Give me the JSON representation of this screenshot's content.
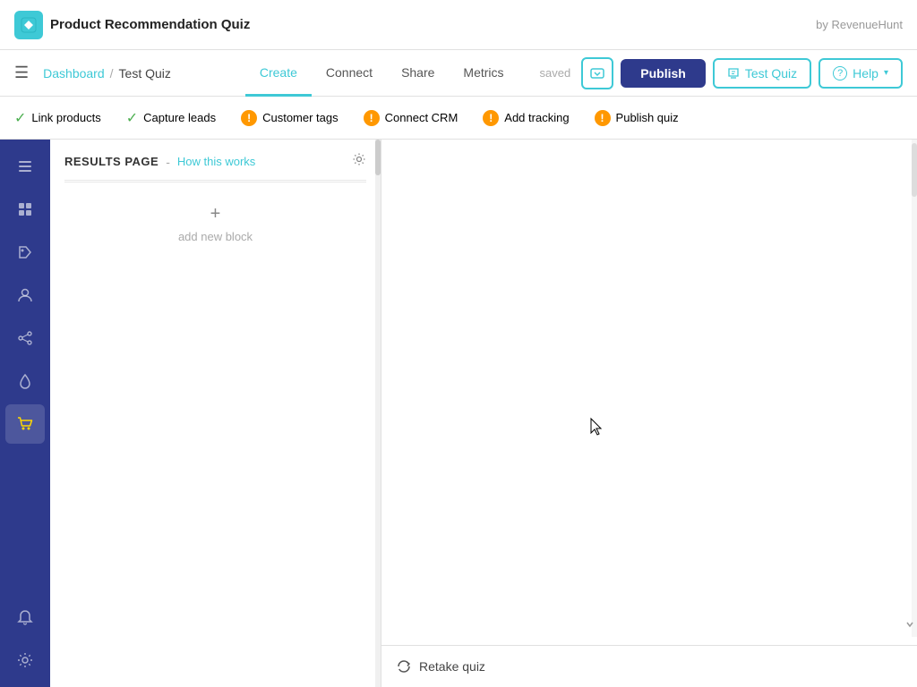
{
  "header": {
    "logo_icon": "◈",
    "title": "Product Recommendation Quiz",
    "by_label": "by RevenueHunt"
  },
  "navbar": {
    "hamburger": "☰",
    "breadcrumb_dashboard": "Dashboard",
    "breadcrumb_sep": "/",
    "breadcrumb_current": "Test Quiz",
    "tabs": [
      {
        "id": "create",
        "label": "Create",
        "active": true
      },
      {
        "id": "connect",
        "label": "Connect",
        "active": false
      },
      {
        "id": "share",
        "label": "Share",
        "active": false
      },
      {
        "id": "metrics",
        "label": "Metrics",
        "active": false
      }
    ],
    "saved_label": "saved",
    "btn_icon_symbol": "⬡",
    "btn_publish_label": "Publish",
    "btn_test_icon": "✎",
    "btn_test_label": "Test Quiz",
    "btn_help_icon": "?",
    "btn_help_label": "Help",
    "btn_help_chevron": "▾"
  },
  "checklist": {
    "items": [
      {
        "id": "link-products",
        "icon": "✓",
        "icon_type": "green",
        "label": "Link products"
      },
      {
        "id": "capture-leads",
        "icon": "✓",
        "icon_type": "green",
        "label": "Capture leads"
      },
      {
        "id": "customer-tags",
        "icon": "!",
        "icon_type": "warning",
        "label": "Customer tags"
      },
      {
        "id": "connect-crm",
        "icon": "!",
        "icon_type": "warning",
        "label": "Connect CRM"
      },
      {
        "id": "add-tracking",
        "icon": "!",
        "icon_type": "warning",
        "label": "Add tracking"
      },
      {
        "id": "publish-quiz",
        "icon": "!",
        "icon_type": "warning",
        "label": "Publish quiz"
      }
    ]
  },
  "sidebar": {
    "icons": [
      {
        "id": "list-icon",
        "symbol": "≡",
        "active": false
      },
      {
        "id": "grid-icon",
        "symbol": "⊞",
        "active": false
      },
      {
        "id": "tag-icon",
        "symbol": "🏷",
        "active": false
      },
      {
        "id": "user-icon",
        "symbol": "👤",
        "active": false
      },
      {
        "id": "share-icon",
        "symbol": "↗",
        "active": false
      },
      {
        "id": "drop-icon",
        "symbol": "💧",
        "active": false
      },
      {
        "id": "cart-icon",
        "symbol": "🛒",
        "active": true
      },
      {
        "id": "bell-icon",
        "symbol": "🔔",
        "active": false
      },
      {
        "id": "settings-icon",
        "symbol": "⚙",
        "active": false
      }
    ]
  },
  "results_panel": {
    "title": "RESULTS PAGE",
    "dash": "-",
    "how_label": "How this works",
    "gear_symbol": "⚙",
    "add_block_plus": "+",
    "add_block_label": "add new block"
  },
  "preview": {
    "retake_icon": "↺",
    "retake_label": "Retake quiz"
  }
}
